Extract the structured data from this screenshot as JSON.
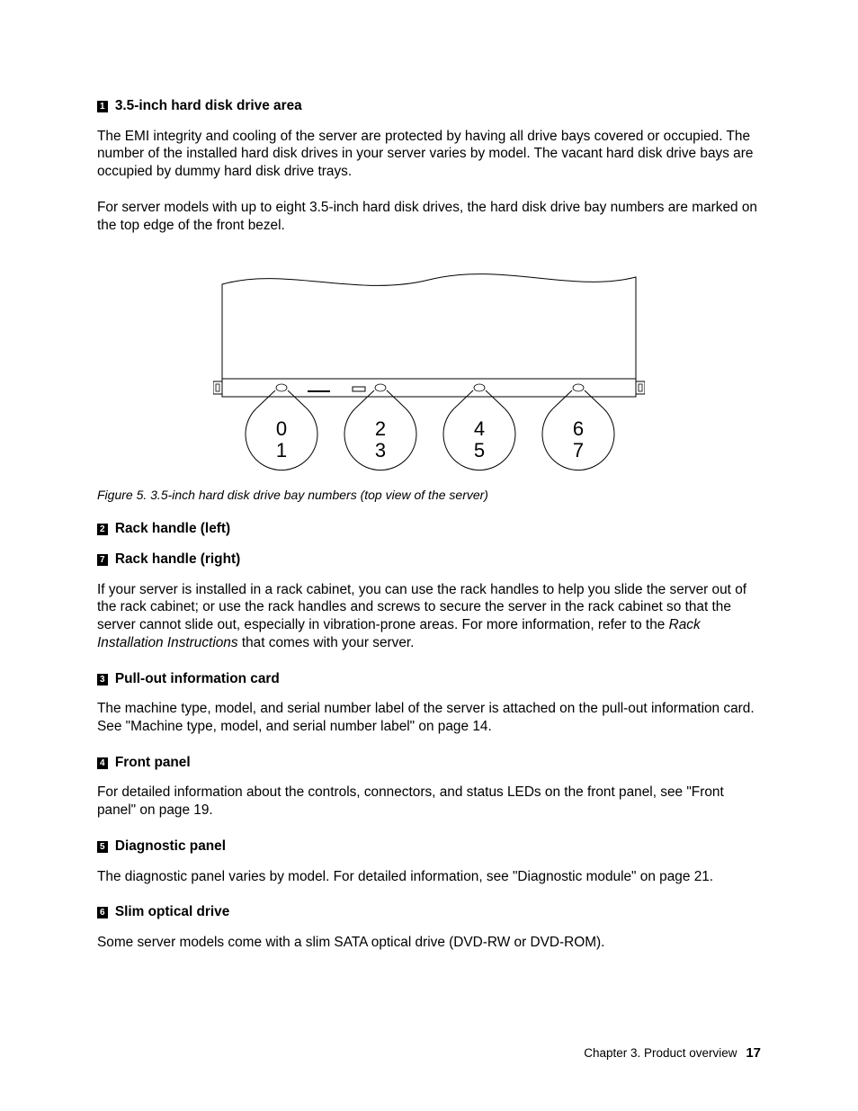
{
  "callouts": {
    "c1": {
      "num": "1",
      "title": "3.5-inch hard disk drive area"
    },
    "c2": {
      "num": "2",
      "title": "Rack handle (left)"
    },
    "c7": {
      "num": "7",
      "title": "Rack handle (right)"
    },
    "c3": {
      "num": "3",
      "title": "Pull-out information card"
    },
    "c4": {
      "num": "4",
      "title": "Front panel"
    },
    "c5": {
      "num": "5",
      "title": "Diagnostic panel"
    },
    "c6": {
      "num": "6",
      "title": "Slim optical drive"
    }
  },
  "paras": {
    "p1a": "The EMI integrity and cooling of the server are protected by having all drive bays covered or occupied. The number of the installed hard disk drives in your server varies by model. The vacant hard disk drive bays are occupied by dummy hard disk drive trays.",
    "p1b": "For server models with up to eight 3.5-inch hard disk drives, the hard disk drive bay numbers are marked on the top edge of the front bezel.",
    "p27a": "If your server is installed in a rack cabinet, you can use the rack handles to help you slide the server out of the rack cabinet; or use the rack handles and screws to secure the server in the rack cabinet so that the server cannot slide out, especially in vibration-prone areas. For more information, refer to the ",
    "p27b": "Rack Installation Instructions",
    "p27c": " that comes with your server.",
    "p3": "The machine type, model, and serial number label of the server is attached on the pull-out information card. See \"Machine type, model, and serial number label\" on page 14.",
    "p4": "For detailed information about the controls, connectors, and status LEDs on the front panel, see \"Front panel\" on page 19.",
    "p5": "The diagnostic panel varies by model. For detailed information, see \"Diagnostic module\" on page 21.",
    "p6": "Some server models come with a slim SATA optical drive (DVD-RW or DVD-ROM)."
  },
  "figure": {
    "caption": "Figure 5.  3.5-inch hard disk drive bay numbers (top view of the server)",
    "bays": [
      {
        "top": "0",
        "bottom": "1"
      },
      {
        "top": "2",
        "bottom": "3"
      },
      {
        "top": "4",
        "bottom": "5"
      },
      {
        "top": "6",
        "bottom": "7"
      }
    ]
  },
  "footer": {
    "chapter": "Chapter 3.  Product overview",
    "page": "17"
  }
}
